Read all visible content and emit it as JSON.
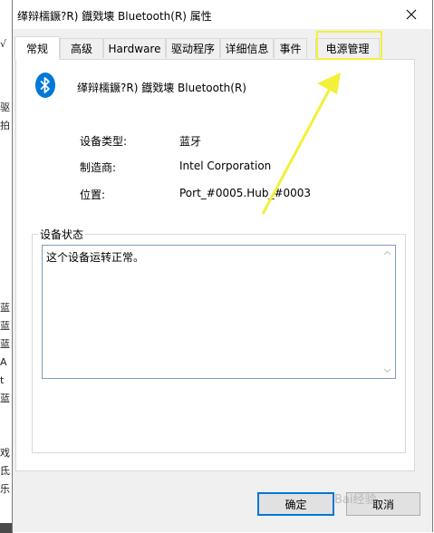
{
  "dialog": {
    "title": "缂辩檽鐝?R) 鐡戣壊 Bluetooth(R) 属性",
    "close_label": "✕"
  },
  "tabs": [
    {
      "label": "常规",
      "active": true
    },
    {
      "label": "高级"
    },
    {
      "label": "Hardware"
    },
    {
      "label": "驱动程序"
    },
    {
      "label": "详细信息"
    },
    {
      "label": "事件"
    },
    {
      "label": "电源管理",
      "highlighted": true
    }
  ],
  "device": {
    "icon": "bluetooth-icon",
    "name": "缂辩檽鐝?R) 鐡戣壊 Bluetooth(R)"
  },
  "properties": [
    {
      "label": "设备类型:",
      "value": "蓝牙"
    },
    {
      "label": "制造商:",
      "value": "Intel Corporation"
    },
    {
      "label": "位置:",
      "value": "Port_#0005.Hub_#0003"
    }
  ],
  "status": {
    "legend": "设备状态",
    "text": "这个设备运转正常。"
  },
  "buttons": {
    "ok": "确定",
    "cancel": "取消"
  },
  "watermark": "Bai经验",
  "background_window": {
    "glyphs": [
      "√",
      "驱",
      "拍",
      "蓝",
      "蓝",
      "蓝",
      "A",
      "t",
      "蓝",
      "戏",
      "氐",
      "乐"
    ]
  },
  "colors": {
    "highlight": "#f2f03a",
    "bluetooth": "#0078d7",
    "ok_border": "#0078d7"
  }
}
